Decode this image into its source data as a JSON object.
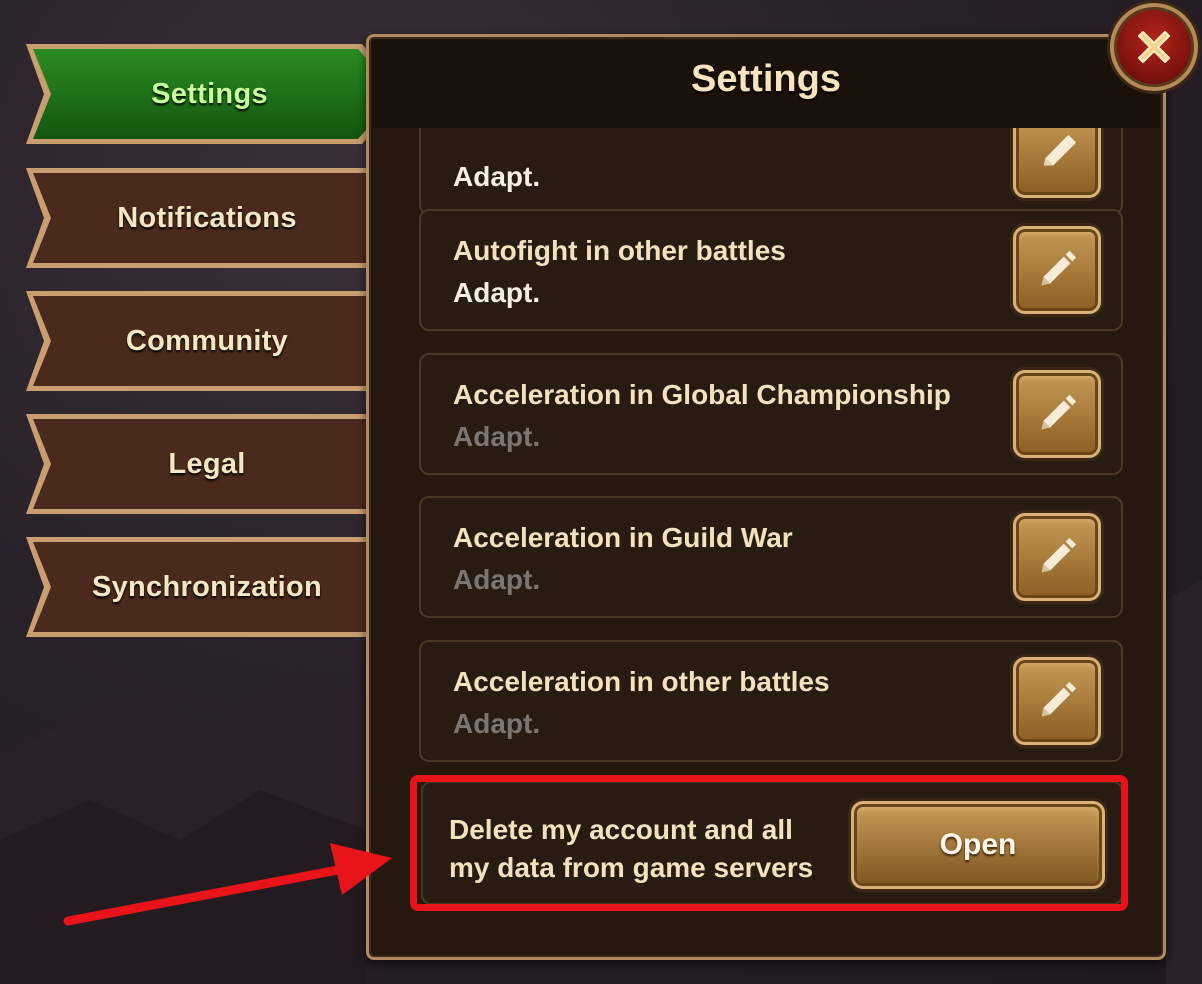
{
  "tabs": [
    {
      "label": "Settings",
      "active": true
    },
    {
      "label": "Notifications",
      "active": false
    },
    {
      "label": "Community",
      "active": false
    },
    {
      "label": "Legal",
      "active": false
    },
    {
      "label": "Synchronization",
      "active": false
    }
  ],
  "panel": {
    "title": "Settings",
    "rows": [
      {
        "title": "",
        "value": "Adapt.",
        "value_enabled": true
      },
      {
        "title": "Autofight in other battles",
        "value": "Adapt.",
        "value_enabled": true
      },
      {
        "title": "Acceleration in Global Championship",
        "value": "Adapt.",
        "value_enabled": false
      },
      {
        "title": "Acceleration in Guild War",
        "value": "Adapt.",
        "value_enabled": false
      },
      {
        "title": "Acceleration in other battles",
        "value": "Adapt.",
        "value_enabled": false
      }
    ],
    "delete_account": {
      "text": "Delete my account and all my data from game servers",
      "button_label": "Open"
    }
  },
  "icons": {
    "edit": "pencil-icon",
    "close": "close-icon"
  },
  "colors": {
    "active_tab": "#1e7a1a",
    "tab": "#4a2a1a",
    "highlight": "#e8141a",
    "button_gold": "#b0803f"
  }
}
